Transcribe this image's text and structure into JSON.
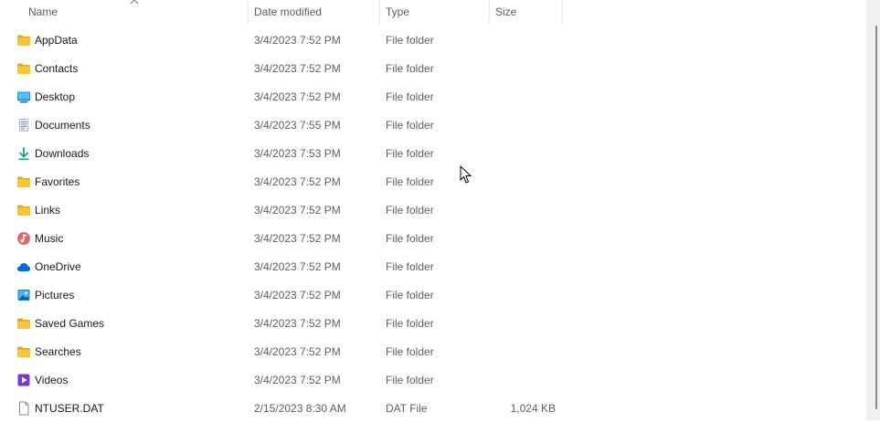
{
  "columns": {
    "name": "Name",
    "date": "Date modified",
    "type": "Type",
    "size": "Size"
  },
  "files": [
    {
      "name": "AppData",
      "date": "3/4/2023 7:52 PM",
      "type": "File folder",
      "size": "",
      "icon": "folder-icon"
    },
    {
      "name": "Contacts",
      "date": "3/4/2023 7:52 PM",
      "type": "File folder",
      "size": "",
      "icon": "folder-icon"
    },
    {
      "name": "Desktop",
      "date": "3/4/2023 7:52 PM",
      "type": "File folder",
      "size": "",
      "icon": "desktop-icon"
    },
    {
      "name": "Documents",
      "date": "3/4/2023 7:55 PM",
      "type": "File folder",
      "size": "",
      "icon": "documents-icon"
    },
    {
      "name": "Downloads",
      "date": "3/4/2023 7:53 PM",
      "type": "File folder",
      "size": "",
      "icon": "download-icon"
    },
    {
      "name": "Favorites",
      "date": "3/4/2023 7:52 PM",
      "type": "File folder",
      "size": "",
      "icon": "folder-icon"
    },
    {
      "name": "Links",
      "date": "3/4/2023 7:52 PM",
      "type": "File folder",
      "size": "",
      "icon": "folder-icon"
    },
    {
      "name": "Music",
      "date": "3/4/2023 7:52 PM",
      "type": "File folder",
      "size": "",
      "icon": "music-icon"
    },
    {
      "name": "OneDrive",
      "date": "3/4/2023 7:52 PM",
      "type": "File folder",
      "size": "",
      "icon": "cloud-icon"
    },
    {
      "name": "Pictures",
      "date": "3/4/2023 7:52 PM",
      "type": "File folder",
      "size": "",
      "icon": "pictures-icon"
    },
    {
      "name": "Saved Games",
      "date": "3/4/2023 7:52 PM",
      "type": "File folder",
      "size": "",
      "icon": "folder-icon"
    },
    {
      "name": "Searches",
      "date": "3/4/2023 7:52 PM",
      "type": "File folder",
      "size": "",
      "icon": "folder-icon"
    },
    {
      "name": "Videos",
      "date": "3/4/2023 7:52 PM",
      "type": "File folder",
      "size": "",
      "icon": "videos-icon"
    },
    {
      "name": "NTUSER.DAT",
      "date": "2/15/2023 8:30 AM",
      "type": "DAT File",
      "size": "1,024 KB",
      "icon": "file-icon"
    }
  ],
  "colors": {
    "folder": "#f8c43a",
    "accent": "#0078d4"
  }
}
